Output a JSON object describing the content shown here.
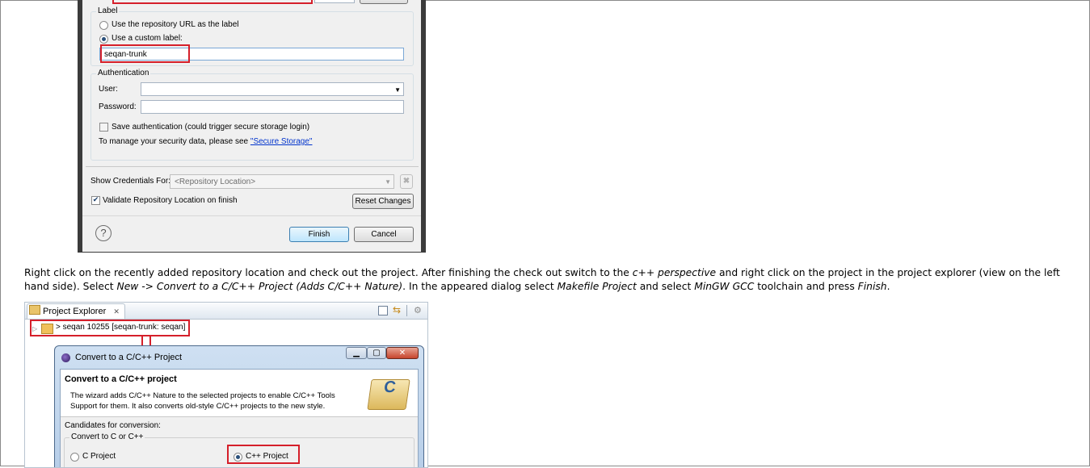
{
  "dialog1": {
    "label_legend": "Label",
    "radio_repo_url": "Use the repository URL as the label",
    "radio_custom": "Use a custom label:",
    "custom_label_value": "seqan-trunk",
    "auth_legend": "Authentication",
    "user_label": "User:",
    "user_value": "",
    "password_label": "Password:",
    "password_value": "",
    "save_auth": "Save authentication (could trigger secure storage login)",
    "manage_text": "To manage your security data, please see ",
    "secure_storage_link": "\"Secure Storage\"",
    "show_creds_label": "Show Credentials For:",
    "show_creds_value": "<Repository Location>",
    "validate_label": "Validate Repository Location on finish",
    "validate_checked": true,
    "reset_button": "Reset Changes",
    "finish_button": "Finish",
    "cancel_button": "Cancel",
    "help_glyph": "?"
  },
  "paragraph": {
    "t1": "Right click on the recently added repository location and check out the project. After finishing the check out switch to the ",
    "i1": "c++ perspective",
    "t2": " and right click on the project in the project explorer (view on the left hand side). Select ",
    "i2": "New -> Convert to a C/C++ Project (Adds C/C++ Nature)",
    "t3": ". In the appeared dialog select ",
    "i3": "Makefile Project",
    "t4": " and select ",
    "i4": "MinGW GCC",
    "t5": " toolchain and press ",
    "i5": "Finish",
    "t6": "."
  },
  "explorer": {
    "tab_label": "Project Explorer",
    "tab_close": "✕",
    "project_node": "> seqan 10255 [seqan-trunk: seqan]"
  },
  "convert_dialog": {
    "window_title": "Convert to a C/C++ Project",
    "banner_title": "Convert to a C/C++ project",
    "banner_desc1": "The wizard adds C/C++ Nature to the selected projects to enable C/C++ Tools",
    "banner_desc2": "Support for them. It also converts old-style C/C++ projects to the new style.",
    "candidates_label": "Candidates for conversion:",
    "convert_legend": "Convert to C or C++",
    "c_project": "C Project",
    "cpp_project": "C++ Project",
    "selected": "cpp"
  },
  "colors": {
    "highlight_red": "#d51f2a",
    "link_blue": "#0033cc",
    "dialog_bg": "#f0f0f0"
  }
}
